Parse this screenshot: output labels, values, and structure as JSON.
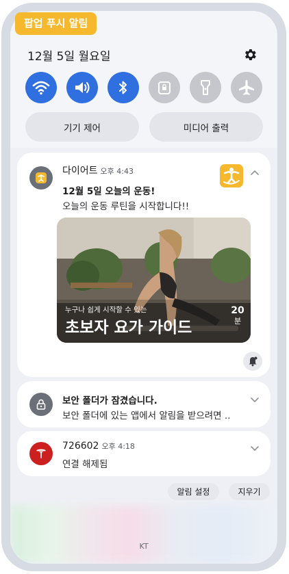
{
  "popup_tag": "팝업 푸시 알림",
  "quick_settings": {
    "date": "12월 5일 월요일",
    "toggles": [
      {
        "name": "wifi",
        "state": "on"
      },
      {
        "name": "sound",
        "state": "on"
      },
      {
        "name": "bluetooth",
        "state": "on"
      },
      {
        "name": "secure-folder",
        "state": "off"
      },
      {
        "name": "flashlight",
        "state": "off"
      },
      {
        "name": "airplane-mode",
        "state": "off"
      }
    ],
    "device_control_label": "기기 제어",
    "media_output_label": "미디어 출력"
  },
  "notifications": [
    {
      "app": "다이어트",
      "time": "오후 4:43",
      "title": "12월 5일 오늘의 운동!",
      "body": "오늘의 운동 루틴을 시작합니다!!",
      "banner": {
        "subtitle": "누구나 쉽게 시작할 수 있는",
        "headline": "초보자 요가 가이드",
        "duration_number": "20",
        "duration_unit": "분"
      }
    },
    {
      "title": "보안 폴더가 잠겼습니다.",
      "body": "보안 폴더에 있는 앱에서 알림을 받으려면 .."
    },
    {
      "app": "726602",
      "time": "오후 4:18",
      "body": "연결 해제됨"
    }
  ],
  "actions": {
    "notification_settings_label": "알림 설정",
    "clear_label": "지우기"
  },
  "carrier": "KT",
  "colors": {
    "accent": "#2f6fe0",
    "tag": "#f6b92e",
    "tesla_red": "#cc1f1f"
  }
}
